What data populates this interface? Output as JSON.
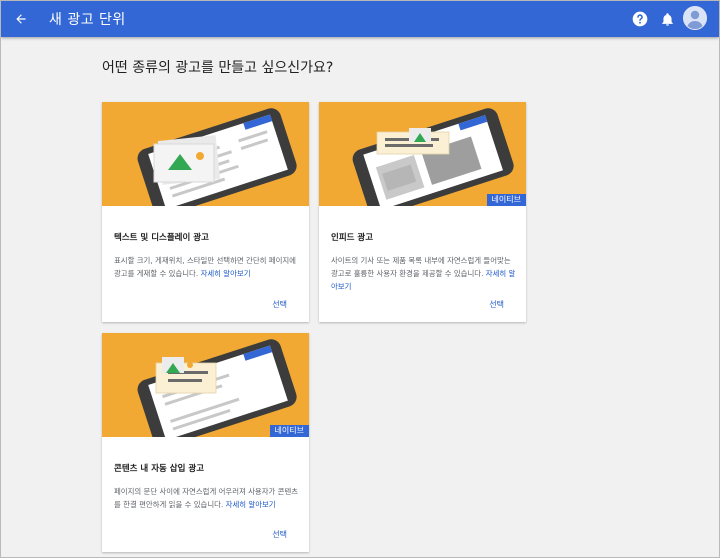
{
  "header": {
    "title": "새 광고 단위",
    "icons": [
      "back-arrow-icon",
      "help-icon",
      "bell-icon",
      "account-icon"
    ]
  },
  "heading": "어떤 종류의 광고를 만들고 싶으신가요?",
  "cards": [
    {
      "title": "텍스트 및 디스플레이 광고",
      "description": "표시할 크기, 게재위치, 스타일만 선택하면 간단히 페이지에 광고를 게재할 수 있습니다.",
      "link": "자세히 알아보기",
      "select": "선택",
      "badge": ""
    },
    {
      "title": "인피드 광고",
      "description": "사이트의 기사 또는 제품 목록 내부에 자연스럽게 들어맞는 광고로 훌륭한 사용자 환경을 제공할 수 있습니다.",
      "link": "자세히 알아보기",
      "select": "선택",
      "badge": "네이티브"
    },
    {
      "title": "콘텐츠 내 자동 삽입 광고",
      "description": "페이지의 문단 사이에 자연스럽게 어우러져 사용자가 콘텐츠를 한결 편안하게 읽을 수 있습니다.",
      "link": "자세히 알아보기",
      "select": "선택",
      "badge": "네이티브"
    }
  ],
  "colors": {
    "header": "#3367d6",
    "card_image_bg": "#f1a934",
    "link": "#1a56c8",
    "badge": "#3367d6"
  }
}
